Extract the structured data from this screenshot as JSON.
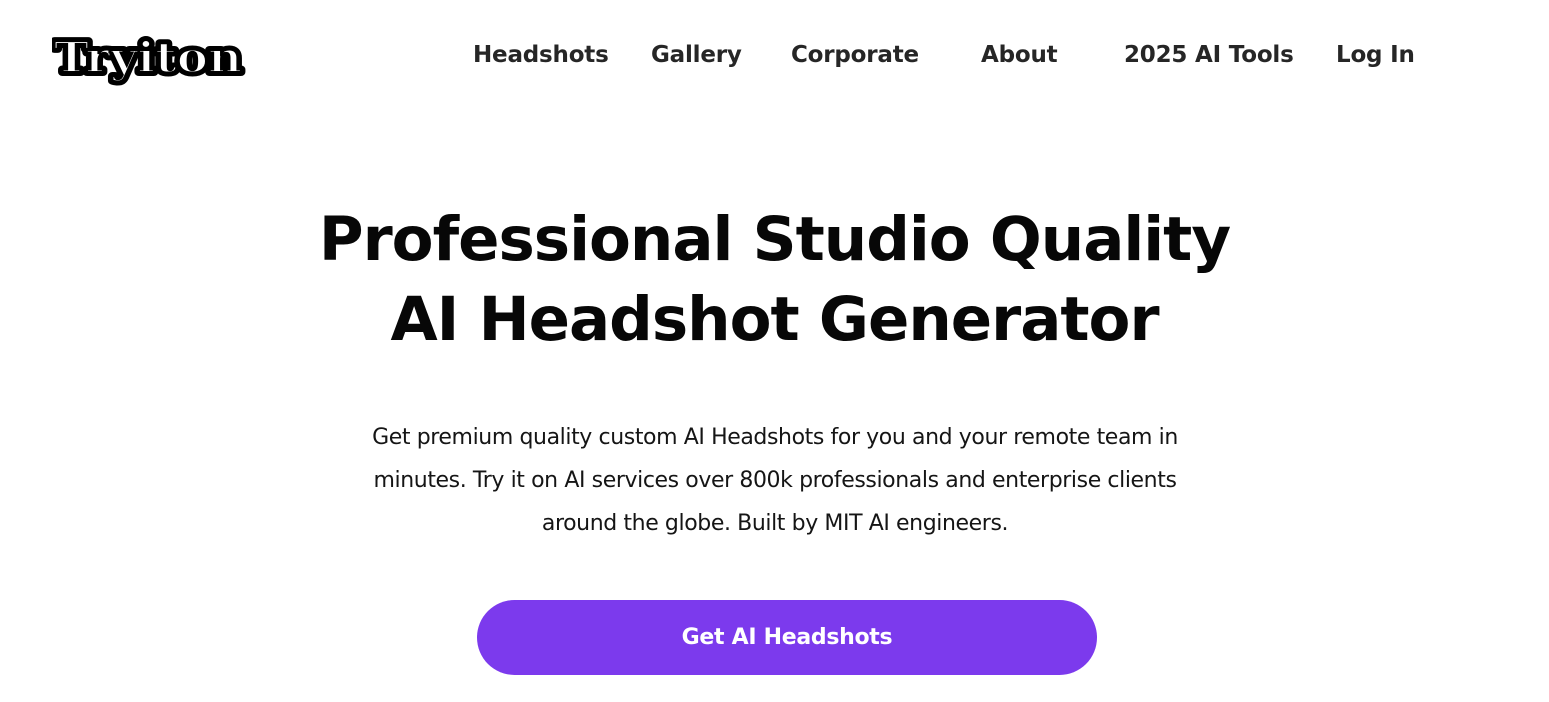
{
  "header": {
    "logo_text": "Tryiton",
    "nav": [
      {
        "label": "Headshots"
      },
      {
        "label": "Gallery"
      },
      {
        "label": "Corporate"
      },
      {
        "label": "About"
      },
      {
        "label": "2025 AI Tools"
      },
      {
        "label": "Log In"
      }
    ]
  },
  "hero": {
    "title_lines": [
      "Professional Studio Quality",
      "AI Headshot Generator"
    ],
    "description_lines": [
      "Get premium quality custom AI Headshots for you and your remote team in",
      "minutes. Try it on AI services over 800k professionals and enterprise clients",
      "around the globe. Built by MIT AI engineers."
    ],
    "cta_label": "Get AI Headshots"
  },
  "colors": {
    "accent": "#7c3aed",
    "text": "#070707",
    "nav_text": "#262626",
    "background": "#ffffff"
  }
}
